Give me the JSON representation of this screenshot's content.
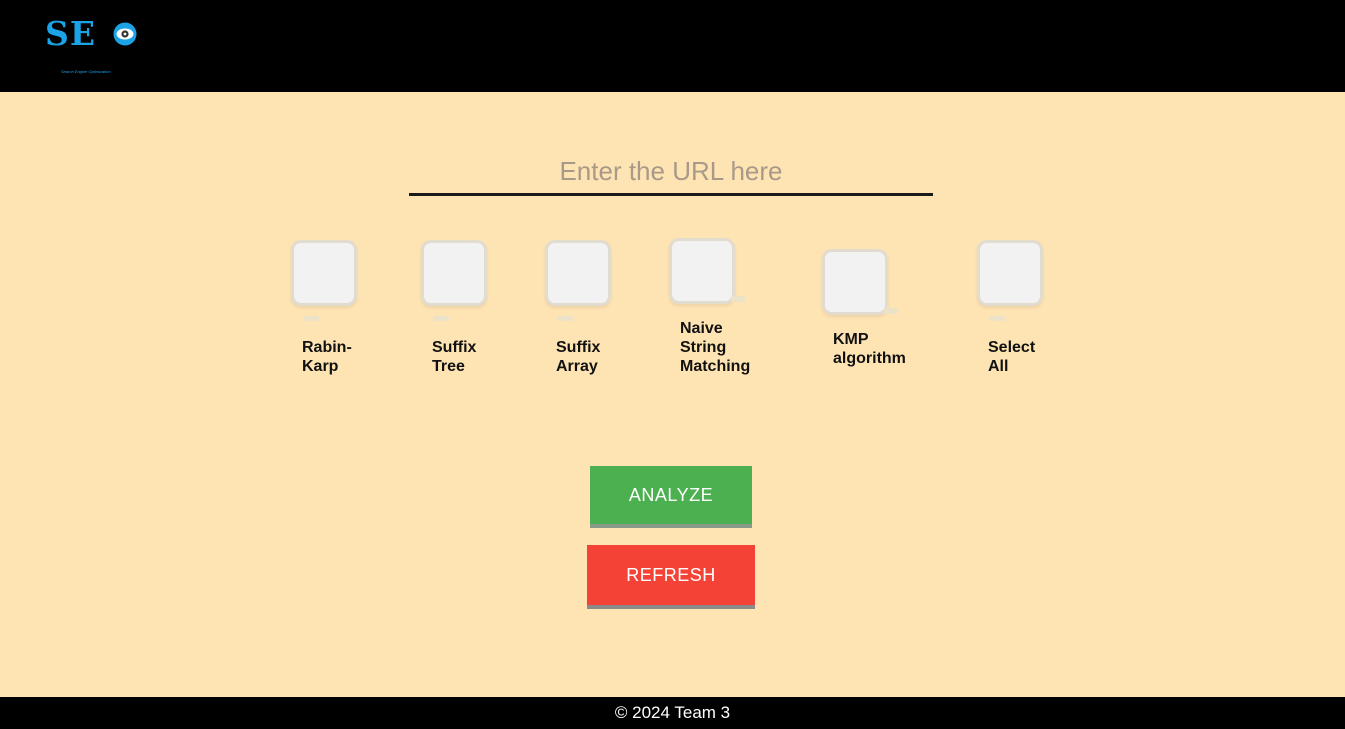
{
  "header": {
    "logo_text": "SE",
    "logo_tagline": "Search Engine Optimization",
    "logo_icon": "eye-icon",
    "brand_color": "#1ba3e8"
  },
  "search": {
    "placeholder": "Enter the URL here",
    "value": ""
  },
  "algorithms": {
    "items": [
      {
        "line1": "Rabin-",
        "line2": "Karp",
        "line3": "",
        "checked": false
      },
      {
        "line1": "Suffix",
        "line2": "Tree",
        "line3": "",
        "checked": false
      },
      {
        "line1": "Suffix",
        "line2": "Array",
        "line3": "",
        "checked": false
      },
      {
        "line1": "Naive",
        "line2": "String",
        "line3": "Matching",
        "checked": false
      },
      {
        "line1": "KMP",
        "line2": "algorithm",
        "line3": "",
        "checked": false
      },
      {
        "line1": "Select",
        "line2": "All",
        "line3": "",
        "checked": false
      }
    ]
  },
  "actions": {
    "analyze_label": "ANALYZE",
    "refresh_label": "REFRESH",
    "analyze_color": "#4caf50",
    "refresh_color": "#f44336"
  },
  "footer": {
    "text": "© 2024 Team 3"
  },
  "theme": {
    "background": "#ffe4b3",
    "bar_color": "#000000"
  }
}
